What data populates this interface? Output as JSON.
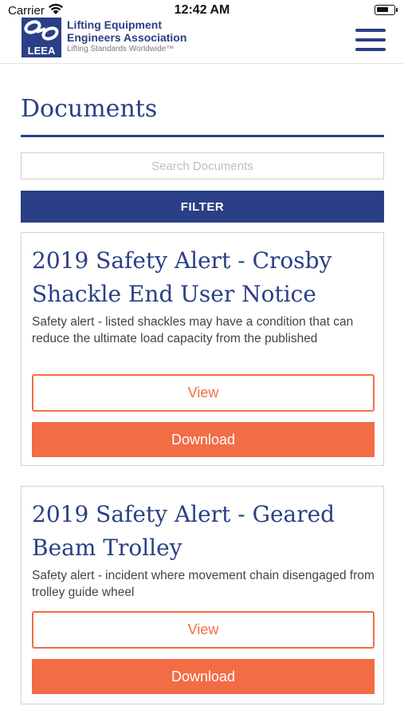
{
  "status_bar": {
    "carrier": "Carrier",
    "time": "12:42 AM",
    "battery_level": 0.75
  },
  "header": {
    "logo_abbr": "LEEA",
    "org_name_line1": "Lifting Equipment",
    "org_name_line2": "Engineers Association",
    "tagline": "Lifting Standards Worldwide™",
    "brand_color": "#2a3f85"
  },
  "page": {
    "title": "Documents"
  },
  "search": {
    "placeholder": "Search Documents",
    "value": ""
  },
  "filter": {
    "label": "FILTER"
  },
  "documents": [
    {
      "title": "2019 Safety Alert - Crosby Shackle End User Notice",
      "description": "Safety alert - listed shackles may have a condition that can reduce the ultimate load capacity from the published",
      "view_label": "View",
      "download_label": "Download"
    },
    {
      "title": "2019 Safety Alert - Geared Beam Trolley",
      "description": "Safety alert - incident where movement chain disengaged from trolley guide wheel",
      "view_label": "View",
      "download_label": "Download"
    }
  ],
  "colors": {
    "accent": "#f26c46",
    "primary": "#2a3f85"
  }
}
